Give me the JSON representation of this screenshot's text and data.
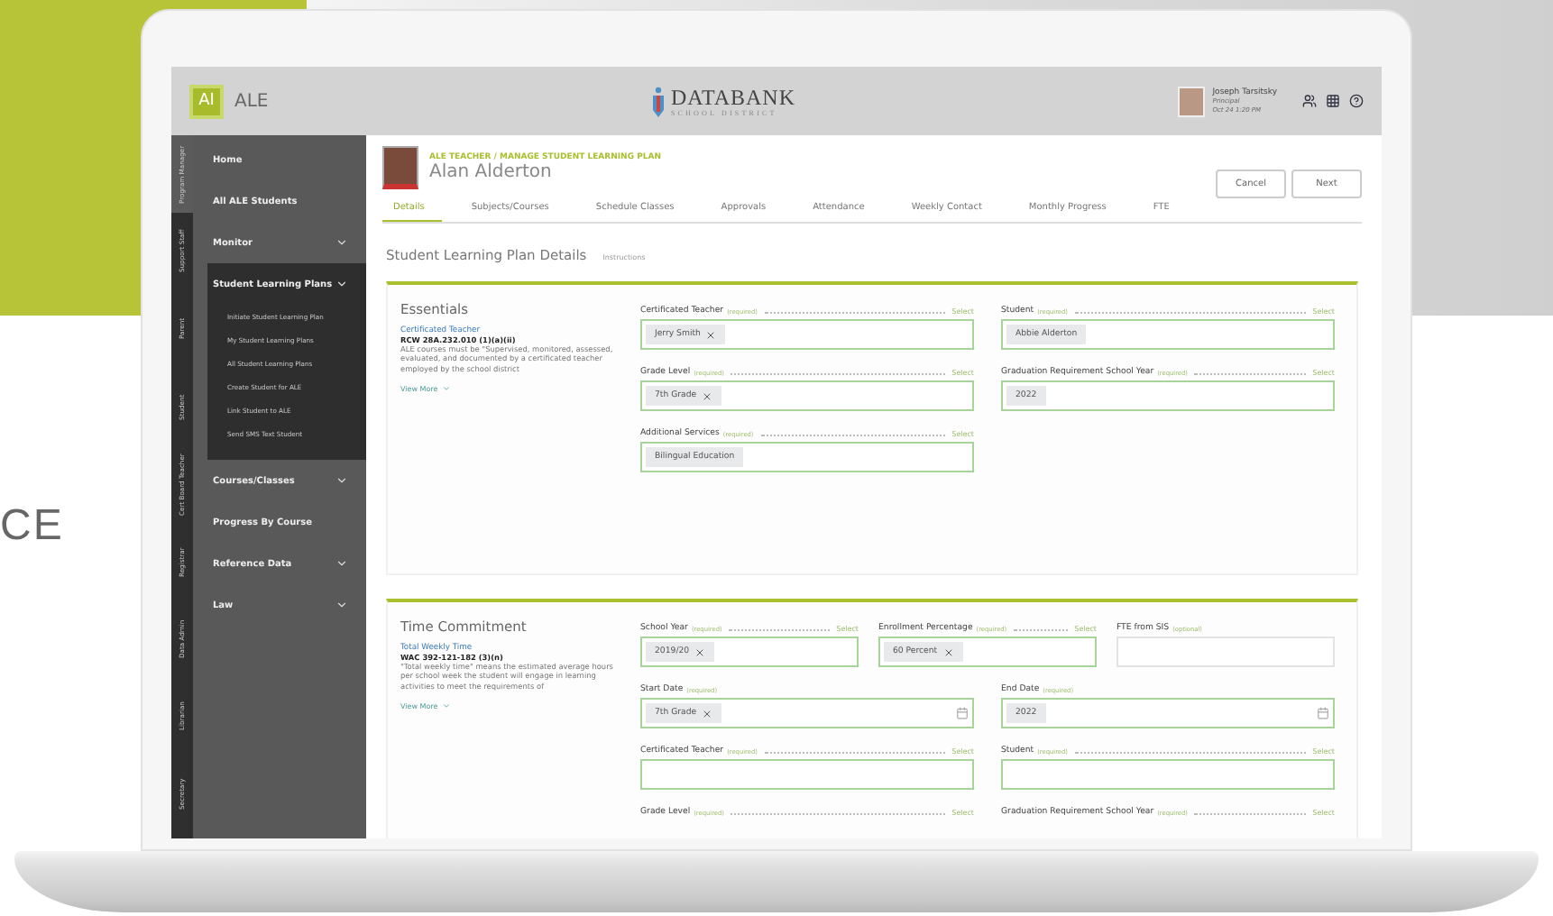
{
  "background": {
    "caption": "CE"
  },
  "header": {
    "logo_badge": "AI",
    "app_name": "ALE",
    "brand": "DATABANK",
    "brand_sub": "SCHOOL DISTRICT",
    "user": {
      "name": "Joseph Tarsitsky",
      "role": "Principal",
      "meta": "Oct 24 1:20 PM"
    }
  },
  "role_tabs": [
    {
      "label": "Program Manager",
      "selected": true
    },
    {
      "label": "Support Staff",
      "selected": false
    },
    {
      "label": "Parent",
      "selected": false
    },
    {
      "label": "Student",
      "selected": false
    },
    {
      "label": "Cert Board Teacher",
      "selected": false
    },
    {
      "label": "Registrar",
      "selected": false
    },
    {
      "label": "Data Admin",
      "selected": false
    },
    {
      "label": "Librarian",
      "selected": false
    },
    {
      "label": "Secretary",
      "selected": false
    }
  ],
  "menu": [
    {
      "label": "Home",
      "kind": "link"
    },
    {
      "label": "All ALE Students",
      "kind": "link"
    },
    {
      "label": "Monitor",
      "kind": "group",
      "expanded": false
    },
    {
      "label": "Student Learning Plans",
      "kind": "group",
      "expanded": true,
      "children": [
        "Initiate Student Learning Plan",
        "My Student Learning Plans",
        "All Student Learning Plans",
        "Create Student for ALE",
        "Link Student to ALE",
        "Send SMS Text Student"
      ]
    },
    {
      "label": "Courses/Classes",
      "kind": "group",
      "expanded": false
    },
    {
      "label": "Progress By Course",
      "kind": "link"
    },
    {
      "label": "Reference Data",
      "kind": "group",
      "expanded": false
    },
    {
      "label": "Law",
      "kind": "group",
      "expanded": false
    }
  ],
  "breadcrumb": "ALE TEACHER / MANAGE STUDENT LEARNING PLAN",
  "student_name": "Alan Alderton",
  "actions": [
    "Cancel",
    "Next"
  ],
  "tabs": [
    {
      "label": "Details",
      "selected": true
    },
    {
      "label": "Subjects/Courses",
      "selected": false
    },
    {
      "label": "Schedule Classes",
      "selected": false
    },
    {
      "label": "Approvals",
      "selected": false
    },
    {
      "label": "Attendance",
      "selected": false
    },
    {
      "label": "Weekly Contact",
      "selected": false
    },
    {
      "label": "Monthly Progress",
      "selected": false
    },
    {
      "label": "FTE",
      "selected": false
    }
  ],
  "page_title": "Student Learning Plan Details",
  "instructions_link": "Instructions",
  "sections": [
    {
      "title": "Essentials",
      "reference": {
        "link": "Certificated Teacher",
        "code": "RCW 28A.232.010 (1)(a)(ii)",
        "text": "ALE courses must be \"Supervised, monitored, assessed, evaluated, and documented by a certificated teacher employed by the school district",
        "more": "View More"
      },
      "rows": [
        [
          {
            "kind": "select",
            "label": "Certificated Teacher",
            "hint": "(required)",
            "action": "Select",
            "chips": [
              {
                "text": "Jerry Smith",
                "removable": true
              }
            ]
          },
          {
            "kind": "select",
            "label": "Student",
            "hint": "(required)",
            "action": "Select",
            "chips": [
              {
                "text": "Abbie Alderton",
                "removable": false
              }
            ]
          }
        ],
        [
          {
            "kind": "select",
            "label": "Grade Level",
            "hint": "(required)",
            "action": "Select",
            "chips": [
              {
                "text": "7th Grade",
                "removable": true
              }
            ]
          },
          {
            "kind": "select",
            "label": "Graduation Requirement School Year",
            "hint": "(required)",
            "action": "Select",
            "chips": [
              {
                "text": "2022",
                "removable": false
              }
            ]
          }
        ],
        [
          {
            "kind": "select",
            "label": "Additional Services",
            "hint": "(required)",
            "action": "Select",
            "chips": [
              {
                "text": "Bilingual Education",
                "removable": false
              }
            ]
          }
        ]
      ]
    },
    {
      "title": "Time Commitment",
      "reference": {
        "link": "Total Weekly Time",
        "code": "WAC 392-121-182 (3)(n)",
        "text": "\"Total weekly time\" means the estimated average hours per school week the student will engage in learning activities to meet the requirements of",
        "more": "View More"
      },
      "rows": [
        [
          {
            "kind": "select",
            "label": "School Year",
            "hint": "(required)",
            "action": "Select",
            "chips": [
              {
                "text": "2019/20",
                "removable": true
              }
            ]
          },
          {
            "kind": "select",
            "label": "Enrollment Percentage",
            "hint": "(required)",
            "action": "Select",
            "chips": [
              {
                "text": "60 Percent",
                "removable": true
              }
            ]
          },
          {
            "kind": "text",
            "label": "FTE from SIS",
            "hint": "(optional)"
          }
        ],
        [
          {
            "kind": "date",
            "label": "Start Date",
            "hint": "(required)",
            "chips": [
              {
                "text": "7th Grade",
                "removable": true
              }
            ]
          },
          {
            "kind": "date",
            "label": "End Date",
            "hint": "(required)",
            "chips": [
              {
                "text": "2022",
                "removable": false
              }
            ]
          }
        ],
        [
          {
            "kind": "select",
            "label": "Certificated Teacher",
            "hint": "(required)",
            "action": "Select"
          },
          {
            "kind": "select",
            "label": "Student",
            "hint": "(required)",
            "action": "Select"
          }
        ],
        [
          {
            "kind": "label",
            "label": "Grade Level",
            "hint": "(required)",
            "action": "Select"
          },
          {
            "kind": "label",
            "label": "Graduation Requirement School Year",
            "hint": "(required)",
            "action": "Select"
          }
        ]
      ]
    }
  ]
}
